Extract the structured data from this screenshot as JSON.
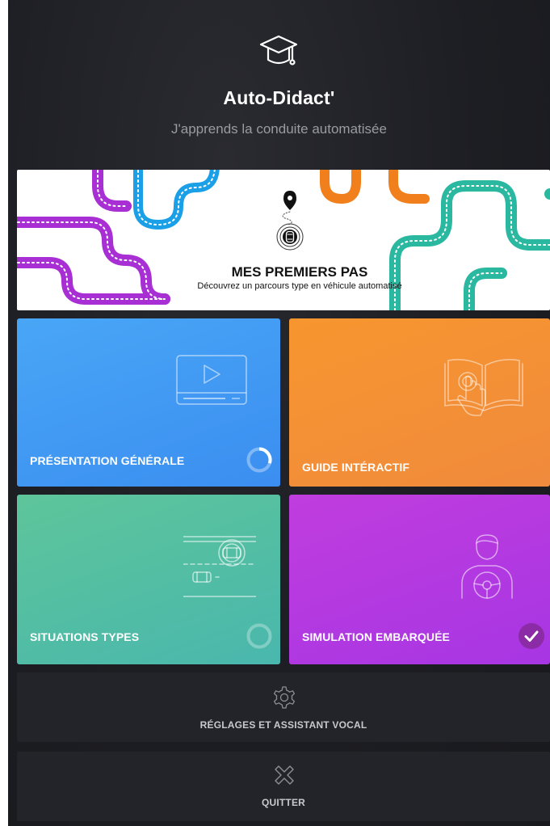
{
  "app": {
    "title": "Auto-Didact'",
    "subtitle": "J'apprends la conduite automatisée"
  },
  "banner": {
    "title": "MES PREMIERS PAS",
    "subtitle": "Découvrez un parcours type en véhicule automatisé"
  },
  "tiles": [
    {
      "label": "PRÉSENTATION GÉNÉRALE",
      "color": "#3b8ef0",
      "status": "in-progress",
      "progress": 0.3,
      "icon": "video-player-icon"
    },
    {
      "label": "GUIDE INTÉRACTIF",
      "color": "#f08a3c",
      "status": "none",
      "icon": "book-touch-icon"
    },
    {
      "label": "SITUATIONS TYPES",
      "color": "#49b7ad",
      "status": "not-started",
      "progress": 0,
      "icon": "traffic-cars-icon"
    },
    {
      "label": "SIMULATION EMBARQUÉE",
      "color": "#a736e3",
      "status": "completed",
      "progress": 1,
      "icon": "driver-steering-icon"
    }
  ],
  "settings": {
    "label": "RÉGLAGES ET ASSISTANT VOCAL",
    "icon": "gear-icon"
  },
  "quit": {
    "label": "QUITTER",
    "icon": "close-icon"
  },
  "colors": {
    "background": "#1d1e23",
    "road_purple": "#a82fd4",
    "road_blue": "#1ba0e8",
    "road_orange": "#f1801c",
    "road_teal": "#2ab8a0"
  }
}
